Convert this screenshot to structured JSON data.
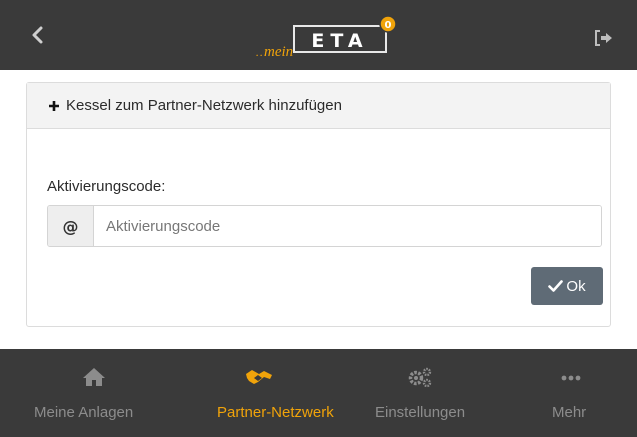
{
  "header": {
    "logo_prefix": "mein",
    "logo_text": "ETA",
    "notification_count": "0"
  },
  "panel": {
    "title": "Kessel zum Partner-Netzwerk hinzufügen",
    "field_label": "Aktivierungscode:",
    "addon_symbol": "@",
    "input_value": "",
    "input_placeholder": "Aktivierungscode",
    "ok_label": "Ok"
  },
  "nav": {
    "items": [
      {
        "label": "Meine Anlagen",
        "icon": "home-icon",
        "active": false
      },
      {
        "label": "Partner-Netzwerk",
        "icon": "handshake-icon",
        "active": true
      },
      {
        "label": "Einstellungen",
        "icon": "cogs-icon",
        "active": false
      },
      {
        "label": "Mehr",
        "icon": "ellipsis-icon",
        "active": false
      }
    ]
  },
  "colors": {
    "header_bg": "#3a3a3a",
    "accent": "#f0a30a",
    "nav_inactive": "#8c8c8c",
    "button_bg": "#5f6b76"
  }
}
